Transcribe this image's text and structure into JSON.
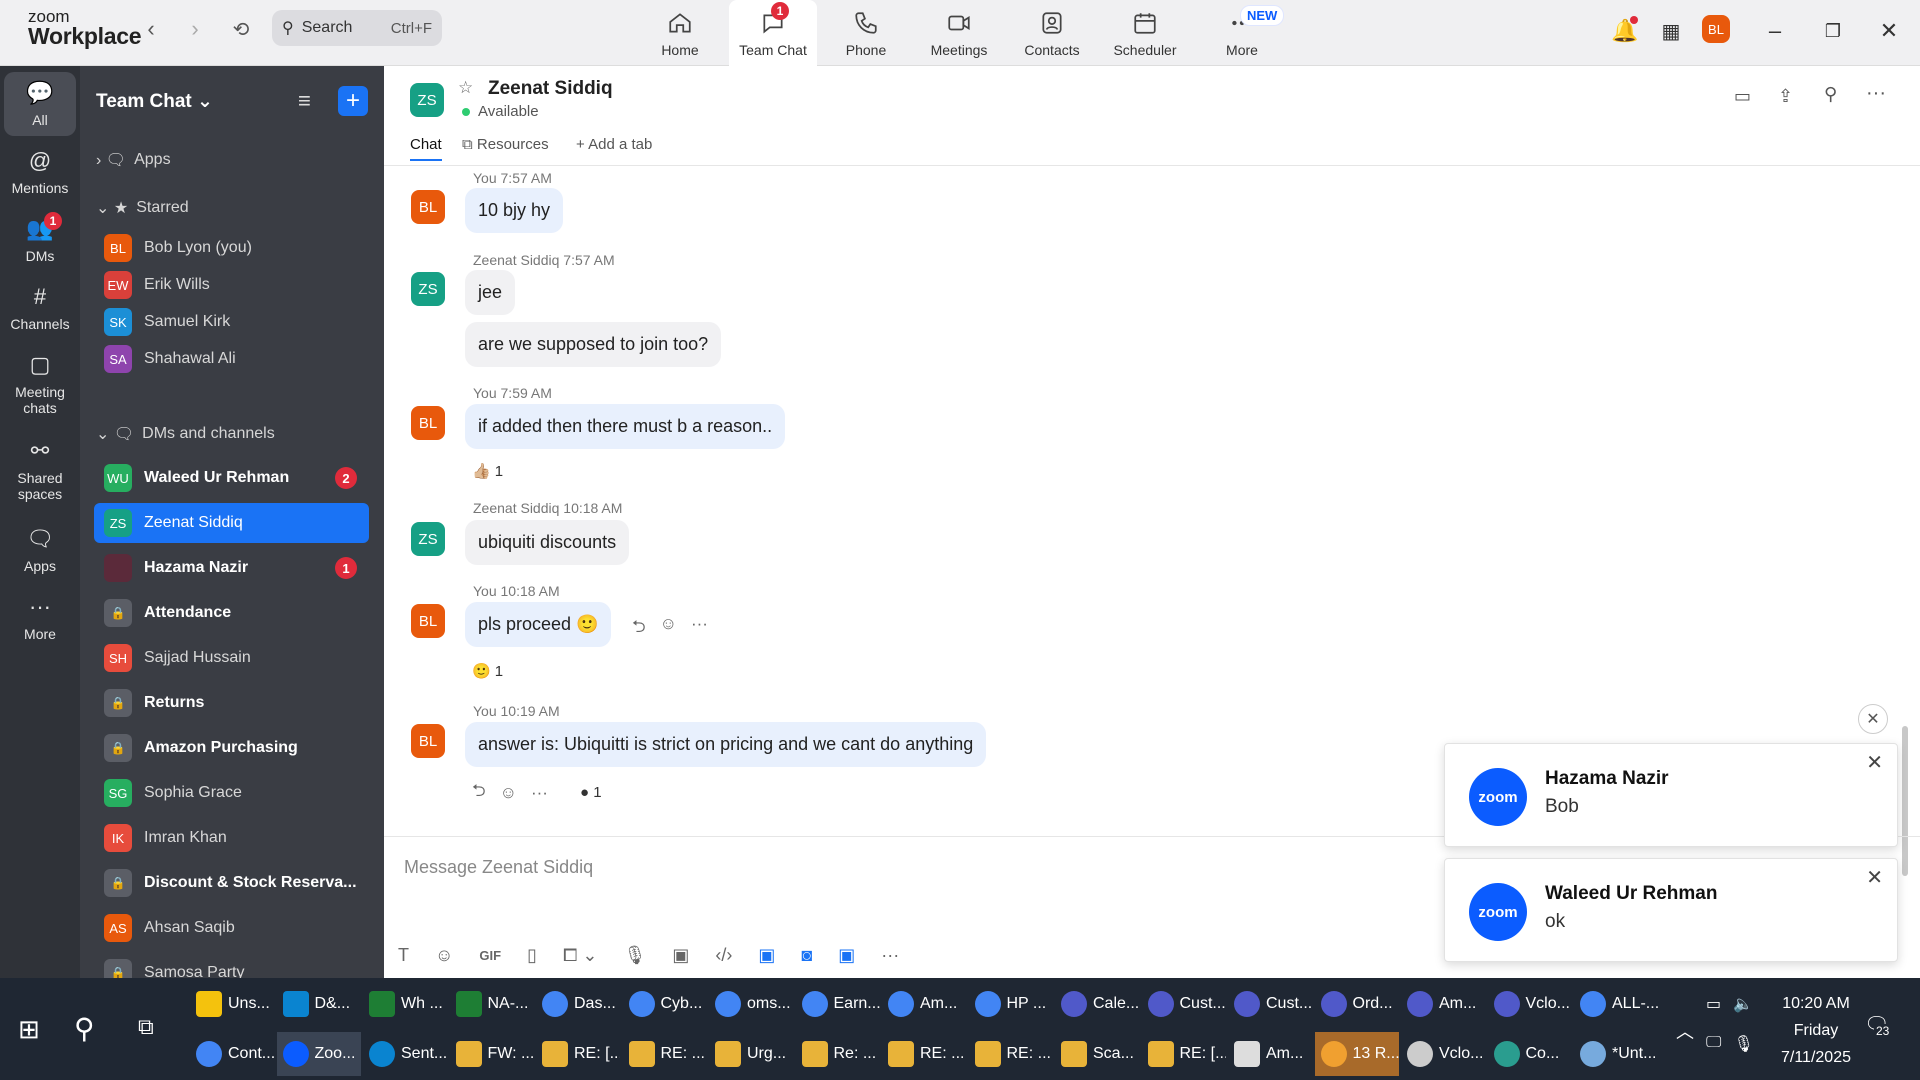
{
  "app": {
    "logo_top": "zoom",
    "logo_bottom": "Workplace"
  },
  "search": {
    "placeholder": "Search",
    "shortcut": "Ctrl+F"
  },
  "tabs": [
    {
      "label": "Home",
      "icon": "home-icon"
    },
    {
      "label": "Team Chat",
      "icon": "chat-icon",
      "badge": "1"
    },
    {
      "label": "Phone",
      "icon": "phone-icon"
    },
    {
      "label": "Meetings",
      "icon": "video-icon"
    },
    {
      "label": "Contacts",
      "icon": "contacts-icon"
    },
    {
      "label": "Scheduler",
      "icon": "calendar-icon"
    },
    {
      "label": "More",
      "icon": "more-icon",
      "tag": "NEW"
    }
  ],
  "user": {
    "initials": "BL",
    "color": "#e8590c"
  },
  "rail": [
    {
      "label": "All",
      "icon": "chat-icon"
    },
    {
      "label": "Mentions",
      "icon": "at-icon"
    },
    {
      "label": "DMs",
      "icon": "people-icon",
      "badge": "1"
    },
    {
      "label": "Channels",
      "icon": "hash-icon"
    },
    {
      "label": "Meeting chats",
      "icon": "calendar-icon"
    },
    {
      "label": "Shared spaces",
      "icon": "share-icon"
    },
    {
      "label": "Apps",
      "icon": "apps-icon"
    },
    {
      "label": "More",
      "icon": "more-icon"
    }
  ],
  "sidebar": {
    "title": "Team Chat",
    "apps_label": "Apps",
    "starred_label": "Starred",
    "dms_label": "DMs and channels",
    "starred": [
      {
        "name": "Bob Lyon (you)",
        "initials": "BL",
        "color": "#e8590c"
      },
      {
        "name": "Erik Wills",
        "initials": "EW",
        "color": "#d9403a"
      },
      {
        "name": "Samuel Kirk",
        "initials": "SK",
        "color": "#1c8fd6"
      },
      {
        "name": "Shahawal Ali",
        "initials": "SA",
        "color": "#8e44ad"
      }
    ],
    "dms": [
      {
        "name": "Waleed Ur Rehman",
        "initials": "WU",
        "color": "#27ae60",
        "bold": true,
        "count": "2"
      },
      {
        "name": "Zeenat Siddiq",
        "initials": "ZS",
        "color": "#16a085",
        "selected": true
      },
      {
        "name": "Hazama Nazir",
        "initials": "",
        "color": "#5b2a3a",
        "bold": true,
        "count": "1"
      },
      {
        "name": "Attendance",
        "lock": true,
        "bold": true
      },
      {
        "name": "Sajjad Hussain",
        "initials": "SH",
        "color": "#e74c3c"
      },
      {
        "name": "Returns",
        "lock": true,
        "bold": true
      },
      {
        "name": "Amazon Purchasing",
        "lock": true,
        "bold": true
      },
      {
        "name": "Sophia Grace",
        "initials": "SG",
        "color": "#27ae60"
      },
      {
        "name": "Imran Khan",
        "initials": "IK",
        "color": "#e74c3c"
      },
      {
        "name": "Discount & Stock Reserva...",
        "lock": true,
        "bold": true
      },
      {
        "name": "Ahsan Saqib",
        "initials": "AS",
        "color": "#e8590c"
      },
      {
        "name": "Samosa Party",
        "lock": true
      }
    ]
  },
  "chat": {
    "contact": "Zeenat Siddiq",
    "initials": "ZS",
    "status": "Available",
    "tab_chat": "Chat",
    "tab_resources": "Resources",
    "tab_add": "Add a tab",
    "composer_placeholder": "Message Zeenat Siddiq",
    "messages": [
      {
        "meta": "You 7:57 AM",
        "text": "10 bjy hy"
      },
      {
        "meta": "Zeenat Siddiq 7:57 AM",
        "text": "jee"
      },
      {
        "text": "are we supposed to join too?"
      },
      {
        "meta": "You 7:59 AM",
        "text": "if added then there must b a reason..",
        "reaction": "👍🏼",
        "count": "1"
      },
      {
        "meta": "Zeenat Siddiq 10:18 AM",
        "text": "ubiquiti discounts"
      },
      {
        "meta": "You 10:18 AM",
        "text": "pls proceed 🙂",
        "reaction": "🙂",
        "count": "1"
      },
      {
        "meta": "You 10:19 AM",
        "text": "answer is: Ubiquitti is strict on pricing and we cant do anything",
        "count": "1"
      }
    ]
  },
  "toasts": [
    {
      "name": "Hazama Nazir",
      "text": "Bob",
      "logo": "zoom"
    },
    {
      "name": "Waleed Ur Rehman",
      "text": "ok",
      "logo": "zoom"
    }
  ],
  "taskbar": {
    "row1": [
      "Uns...",
      "D&...",
      "Wh ...",
      "NA-...",
      "Das...",
      "Cyb...",
      "oms...",
      "Earn...",
      "Am...",
      "HP ...",
      "Cale...",
      "Cust...",
      "Cust...",
      "Ord...",
      "Am...",
      "Vclo...",
      "ALL-..."
    ],
    "row2": [
      "Cont...",
      "Zoo...",
      "Sent...",
      "FW: ...",
      "RE: [...",
      "RE: ...",
      "Urg...",
      "Re: ...",
      "RE: ...",
      "RE: ...",
      "Sca...",
      "RE: [...",
      "Am...",
      "13 R...",
      "Vclo...",
      "Co...",
      "*Unt..."
    ],
    "time": "10:20 AM",
    "day": "Friday",
    "date": "7/11/2025",
    "notif_count": "23"
  }
}
